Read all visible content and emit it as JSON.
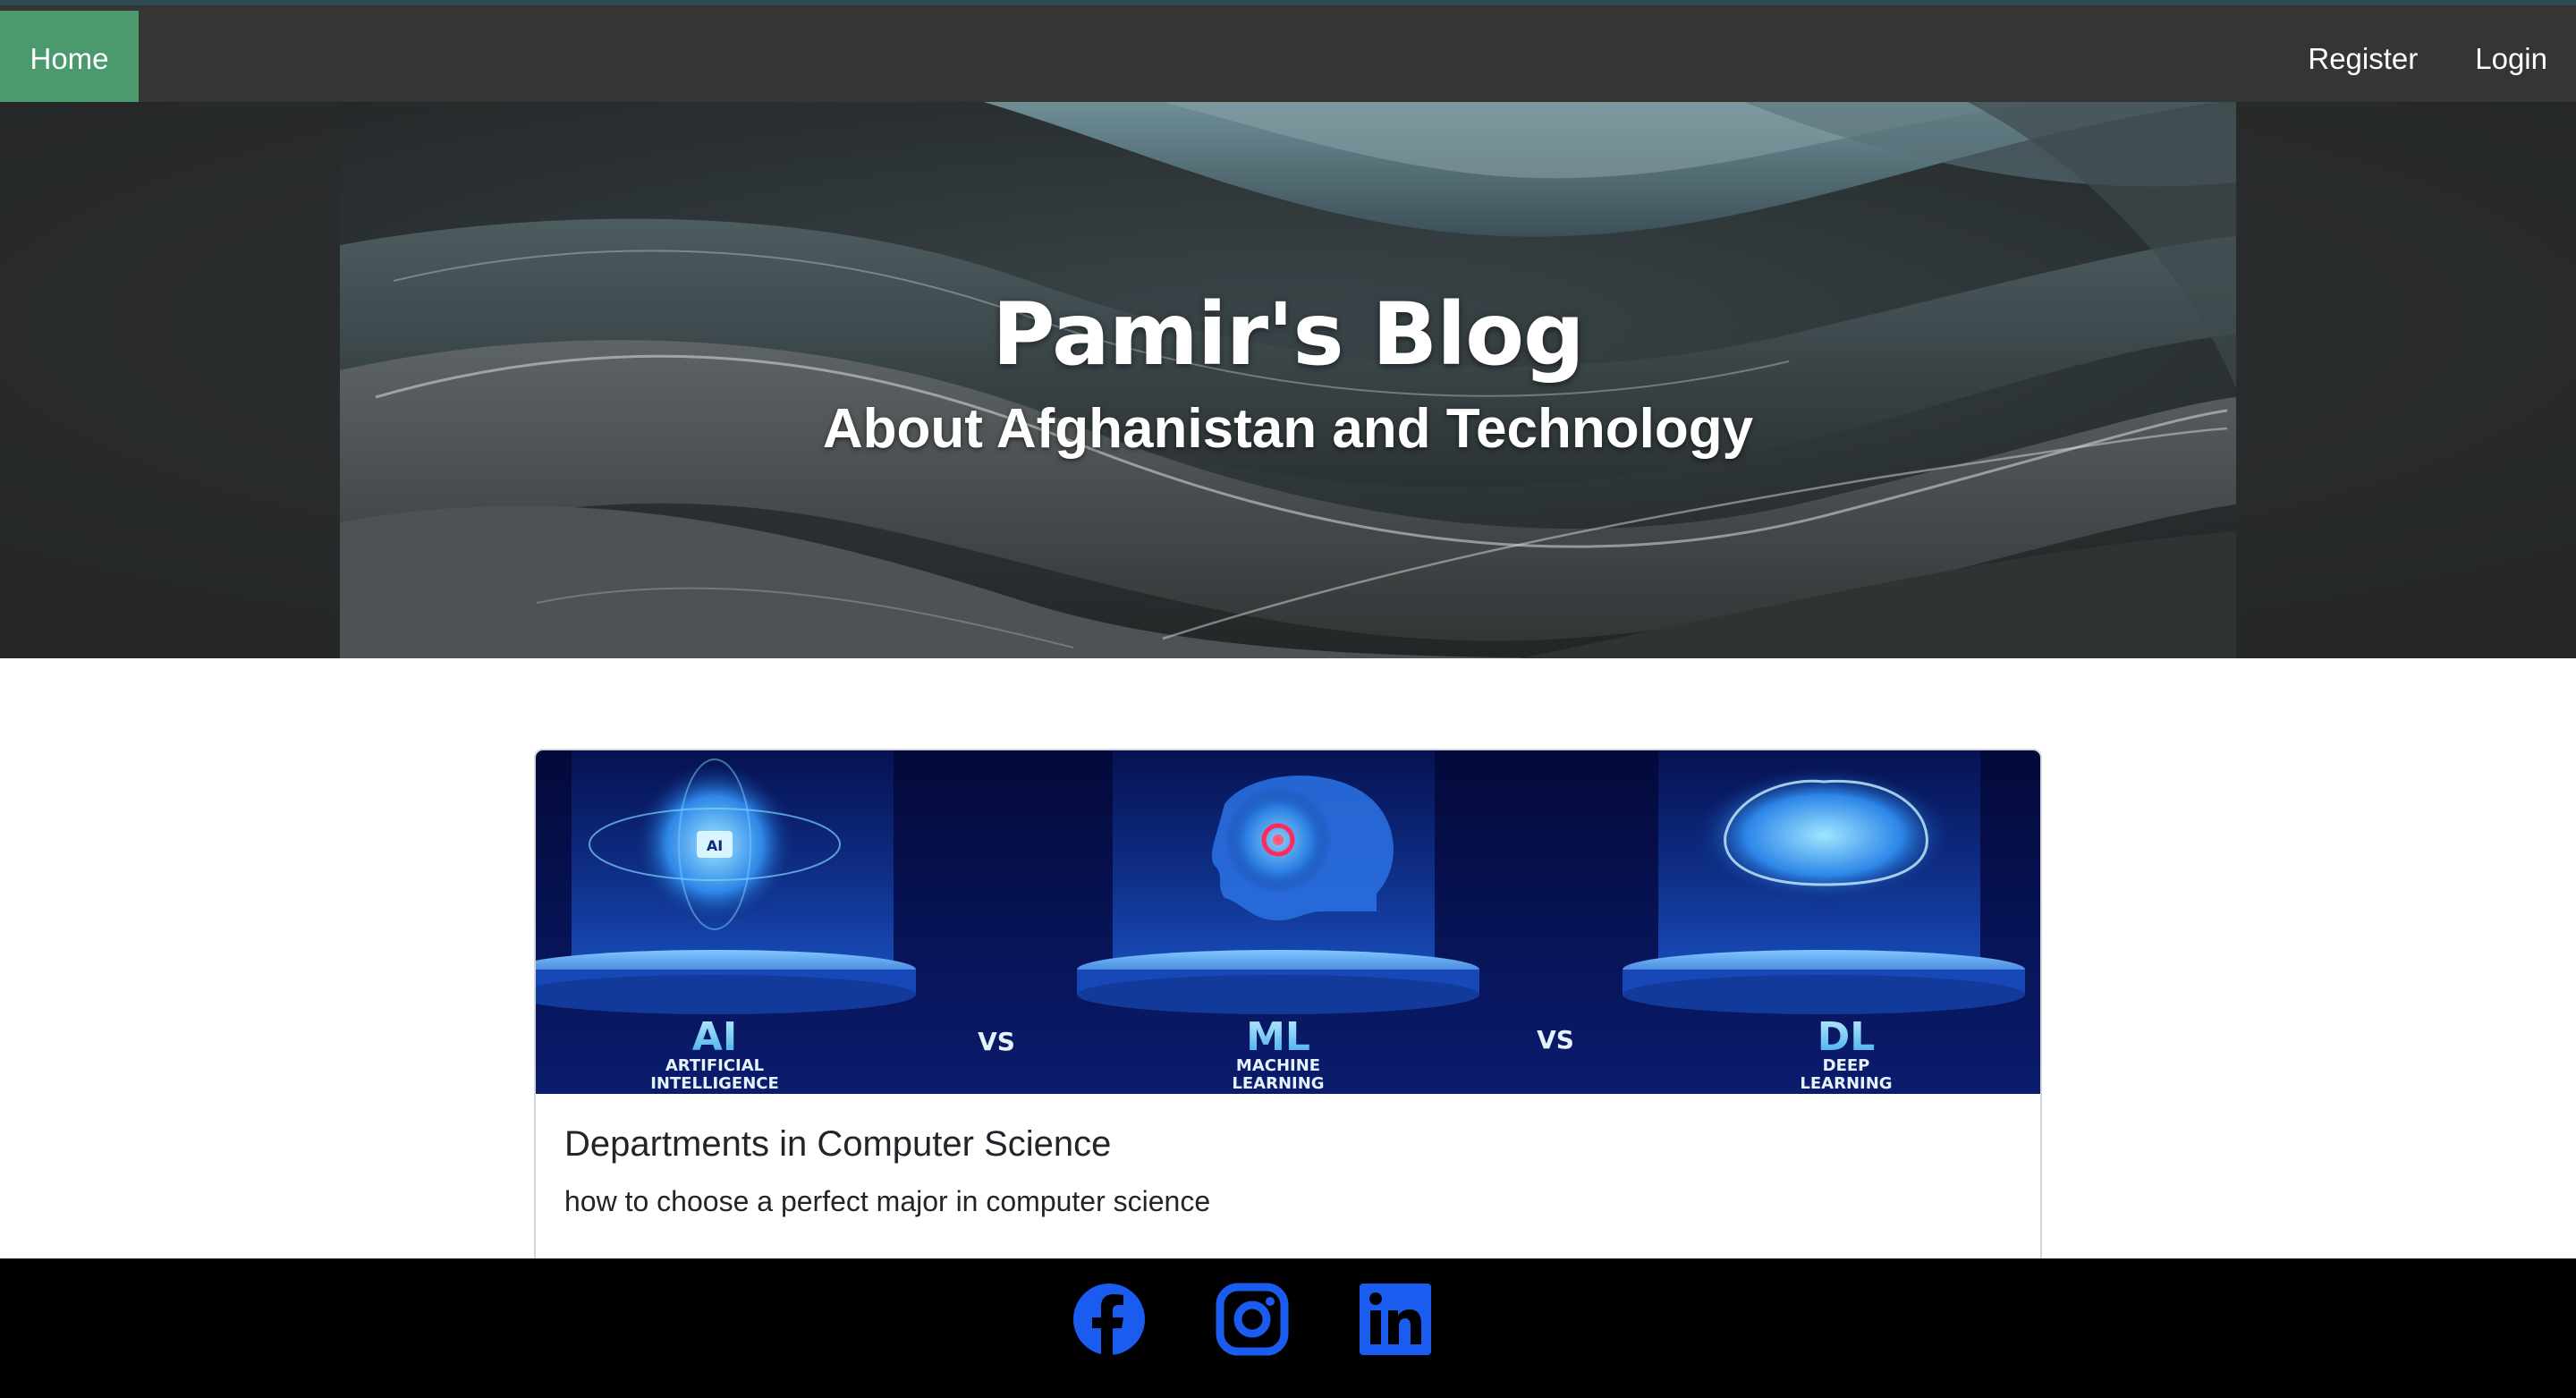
{
  "nav": {
    "home_label": "Home",
    "register_label": "Register",
    "login_label": "Login"
  },
  "hero": {
    "title": "Pamir's Blog",
    "subtitle": "About Afghanistan and Technology"
  },
  "post": {
    "image_labels": {
      "ai": "AI",
      "ai_sub1": "ARTIFICIAL",
      "ai_sub2": "INTELLIGENCE",
      "vs1": "VS",
      "ml": "ML",
      "ml_sub1": "MACHINE",
      "ml_sub2": "LEARNING",
      "vs2": "VS",
      "dl": "DL",
      "dl_sub1": "DEEP",
      "dl_sub2": "LEARNING",
      "chip": "AI"
    },
    "title": "Departments in Computer Science",
    "subtitle": "how to choose a perfect major in computer science"
  },
  "footer": {
    "icons": [
      "facebook-icon",
      "instagram-icon",
      "linkedin-icon"
    ],
    "icon_color": "#1877f2"
  },
  "colors": {
    "nav_bg": "#353535",
    "home_active_bg": "#4a9a6d",
    "footer_bg": "#000000"
  }
}
